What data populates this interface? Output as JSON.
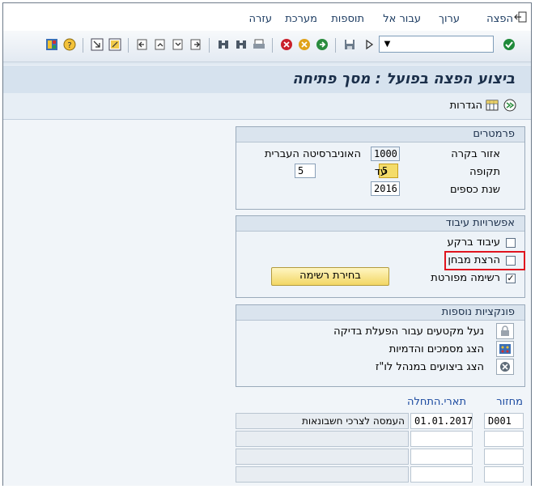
{
  "menu": {
    "items": [
      "הפצה",
      "ערוך",
      "עבור אל",
      "תוספות",
      "מערכת",
      "עזרה"
    ]
  },
  "toolbar": {
    "command_field_value": ""
  },
  "title": "ביצוע הפצה בפועל : מסך פתיחה",
  "app_toolbar": {
    "settings_label": "הגדרות"
  },
  "parameters": {
    "header": "פרמטרים",
    "controlling_area_label": "אזור בקרה",
    "controlling_area_value": "1000",
    "controlling_area_text": "האוניברסיטה העברית",
    "period_label": "תקופה",
    "period_from": "5",
    "period_to_label": "עד",
    "period_to": "5",
    "fiscal_year_label": "שנת כספים",
    "fiscal_year": "2016"
  },
  "processing": {
    "header": "אפשרויות עיבוד",
    "background_label": "עיבוד ברקע",
    "background_checked": false,
    "test_run_label": "הרצת מבחן",
    "test_run_checked": false,
    "detail_list_label": "רשימה מפורטת",
    "detail_list_checked": true,
    "layout_button": "בחירת רשימה"
  },
  "functions": {
    "header": "פונקציות נוספות",
    "lock_label": "נעל מקטעים עבור הפעלת בדיקה",
    "docs_label": "הצג מסמכים והדמיות",
    "scheduler_label": "הצג ביצועים במנהל לו\"ז"
  },
  "cycles": {
    "col_cycle": "מחזור",
    "col_start_date": "תארי.התחלה",
    "rows": [
      {
        "cycle": "D001",
        "start_date": "01.01.2017",
        "text": "העמסה לצרכי חשבונאות"
      },
      {
        "cycle": "",
        "start_date": "",
        "text": ""
      },
      {
        "cycle": "",
        "start_date": "",
        "text": ""
      },
      {
        "cycle": "",
        "start_date": "",
        "text": ""
      }
    ]
  },
  "colors": {
    "highlight": "#e0141e",
    "title_text": "#1b2f4a",
    "button_fill": "#f2d664"
  }
}
